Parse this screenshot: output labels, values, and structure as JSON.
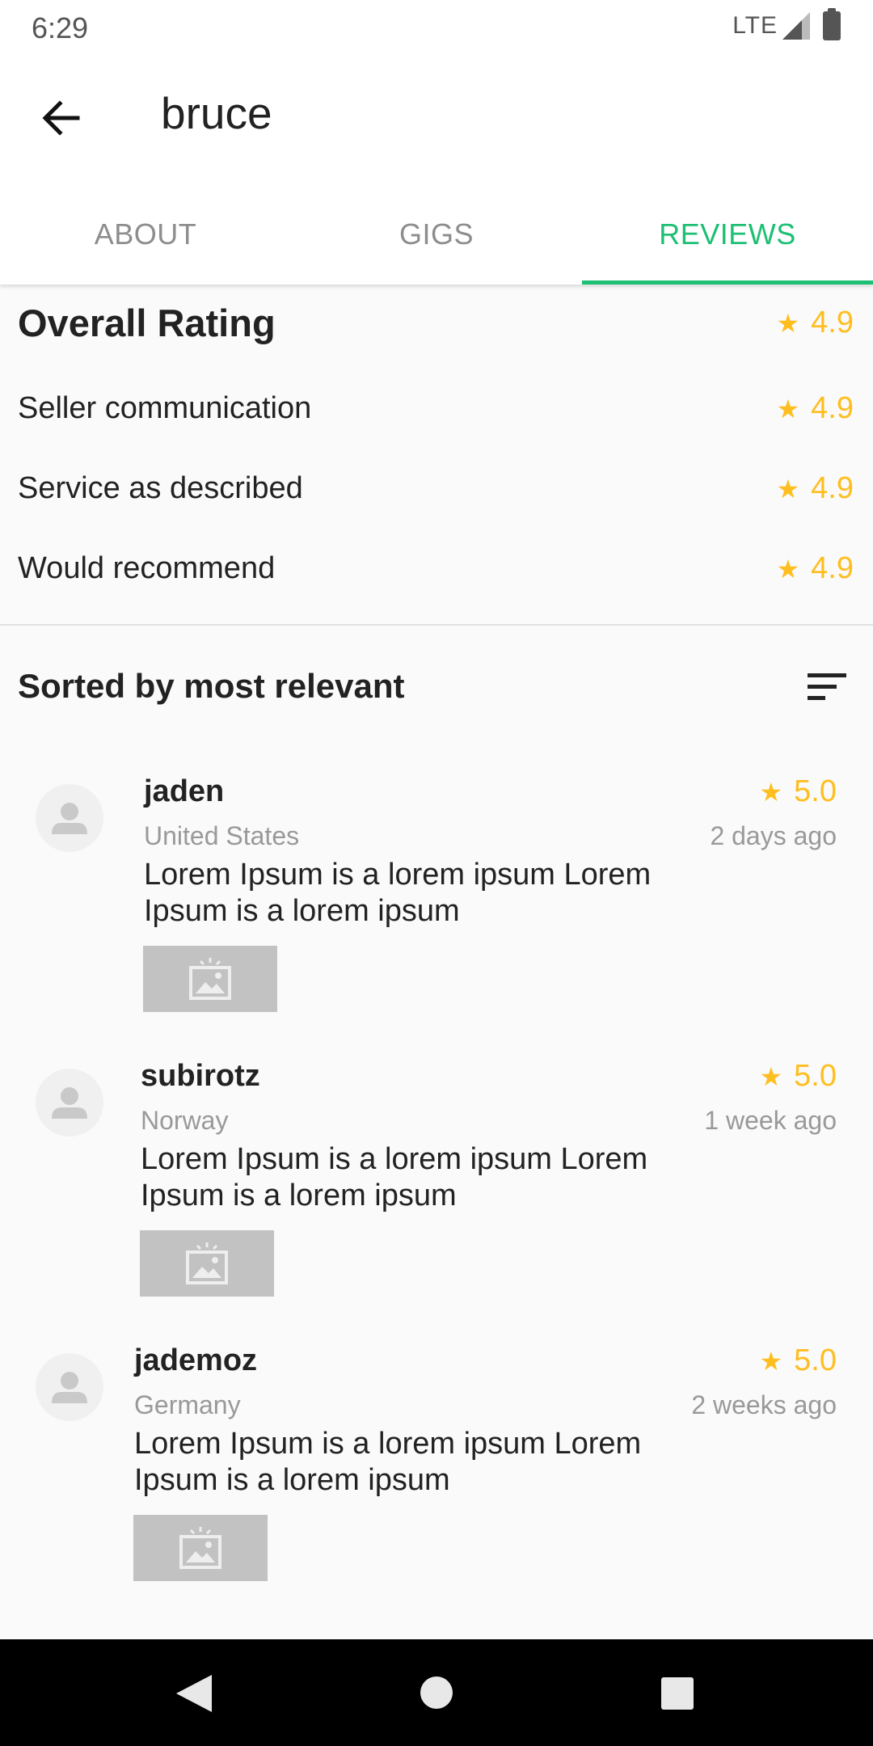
{
  "status": {
    "time": "6:29",
    "network": "LTE"
  },
  "header": {
    "title": "bruce"
  },
  "tabs": [
    {
      "label": "ABOUT",
      "active": false
    },
    {
      "label": "GIGS",
      "active": false
    },
    {
      "label": "REVIEWS",
      "active": true
    }
  ],
  "ratings": {
    "overall": {
      "label": "Overall Rating",
      "value": "4.9"
    },
    "items": [
      {
        "label": "Seller communication",
        "value": "4.9"
      },
      {
        "label": "Service as described",
        "value": "4.9"
      },
      {
        "label": "Would recommend",
        "value": "4.9"
      }
    ]
  },
  "sort": {
    "label": "Sorted by most relevant"
  },
  "reviews": [
    {
      "name": "jaden",
      "country": "United States",
      "rating": "5.0",
      "time": "2 days ago",
      "text": "Lorem Ipsum is a lorem ipsum Lorem Ipsum is a lorem ipsum"
    },
    {
      "name": "subirotz",
      "country": "Norway",
      "rating": "5.0",
      "time": "1 week ago",
      "text": "Lorem Ipsum is a lorem ipsum Lorem Ipsum is a lorem ipsum"
    },
    {
      "name": "jademoz",
      "country": "Germany",
      "rating": "5.0",
      "time": "2 weeks ago",
      "text": "Lorem Ipsum is a lorem ipsum Lorem Ipsum is a lorem ipsum"
    }
  ],
  "colors": {
    "accent": "#1dbf73",
    "star": "#ffbe1f",
    "muted": "#999999"
  },
  "icons": [
    "arrow-back-icon",
    "star-icon",
    "sort-icon",
    "avatar-person-icon",
    "image-placeholder-icon"
  ]
}
